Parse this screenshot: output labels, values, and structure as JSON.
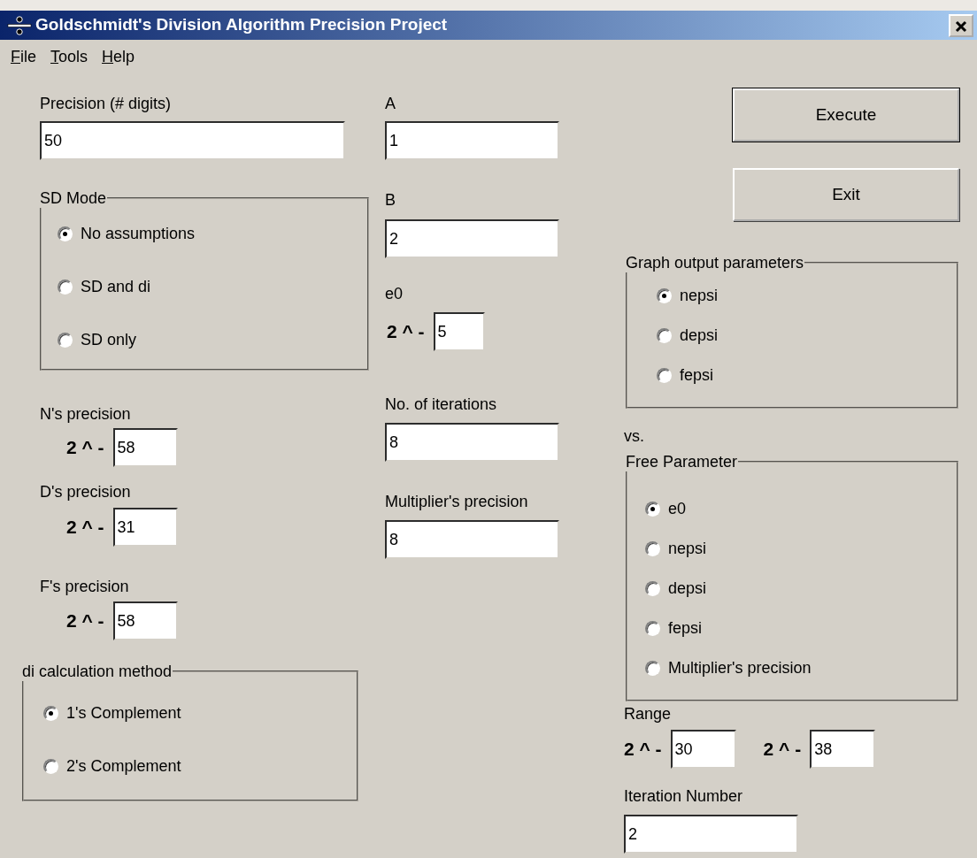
{
  "window": {
    "title": "Goldschmidt's Division Algorithm Precision Project"
  },
  "menu": [
    {
      "label": "File"
    },
    {
      "label": "Tools"
    },
    {
      "label": "Help"
    }
  ],
  "columns": [
    [
      {
        "kind": "field",
        "label": "Precision (# digits)",
        "value": "50"
      },
      {
        "kind": "radio_group",
        "title": "SD Mode",
        "options": [
          {
            "label": "No assumptions",
            "selected": true
          },
          {
            "label": "SD and di",
            "selected": false
          },
          {
            "label": "SD only",
            "selected": false
          }
        ]
      },
      {
        "kind": "power_field",
        "label": "N's precision",
        "fields": [
          {
            "prefix": "2 ^ -",
            "value": "58"
          }
        ]
      },
      {
        "kind": "power_field",
        "label": "D's precision",
        "fields": [
          {
            "prefix": "2 ^ -",
            "value": "31"
          }
        ]
      },
      {
        "kind": "power_field",
        "label": "F's precision",
        "fields": [
          {
            "prefix": "2 ^ -",
            "value": "58"
          }
        ]
      },
      {
        "kind": "radio_group",
        "title": "di calculation method",
        "options": [
          {
            "label": "1's Complement",
            "selected": true
          },
          {
            "label": "2's Complement",
            "selected": false
          }
        ]
      }
    ],
    [
      {
        "kind": "field",
        "label": "A",
        "value": "1"
      },
      {
        "kind": "field",
        "label": "B",
        "value": "2"
      },
      {
        "kind": "power_field",
        "label": "e0",
        "fields": [
          {
            "prefix": "2 ^ -",
            "value": "5"
          }
        ]
      },
      {
        "kind": "field",
        "label": "No. of iterations",
        "value": "8"
      },
      {
        "kind": "field",
        "label": "Multiplier's precision",
        "value": "8"
      }
    ],
    [
      {
        "kind": "button",
        "label": "Execute"
      },
      {
        "kind": "button",
        "label": "Exit"
      },
      {
        "kind": "radio_group",
        "title": "Graph output parameters",
        "options": [
          {
            "label": "nepsi",
            "selected": true
          },
          {
            "label": "depsi",
            "selected": false
          },
          {
            "label": "fepsi",
            "selected": false
          }
        ]
      },
      {
        "kind": "text",
        "label": "vs."
      },
      {
        "kind": "radio_group",
        "title": "Free Parameter",
        "options": [
          {
            "label": "e0",
            "selected": true
          },
          {
            "label": "nepsi",
            "selected": false
          },
          {
            "label": "depsi",
            "selected": false
          },
          {
            "label": "fepsi",
            "selected": false
          },
          {
            "label": "Multiplier's precision",
            "selected": false
          }
        ]
      },
      {
        "kind": "power_field",
        "label": "Range",
        "fields": [
          {
            "prefix": "2 ^ -",
            "value": "30"
          },
          {
            "prefix": "2 ^ -",
            "value": "38"
          }
        ]
      },
      {
        "kind": "field",
        "label": "Iteration Number",
        "value": "2"
      }
    ]
  ]
}
